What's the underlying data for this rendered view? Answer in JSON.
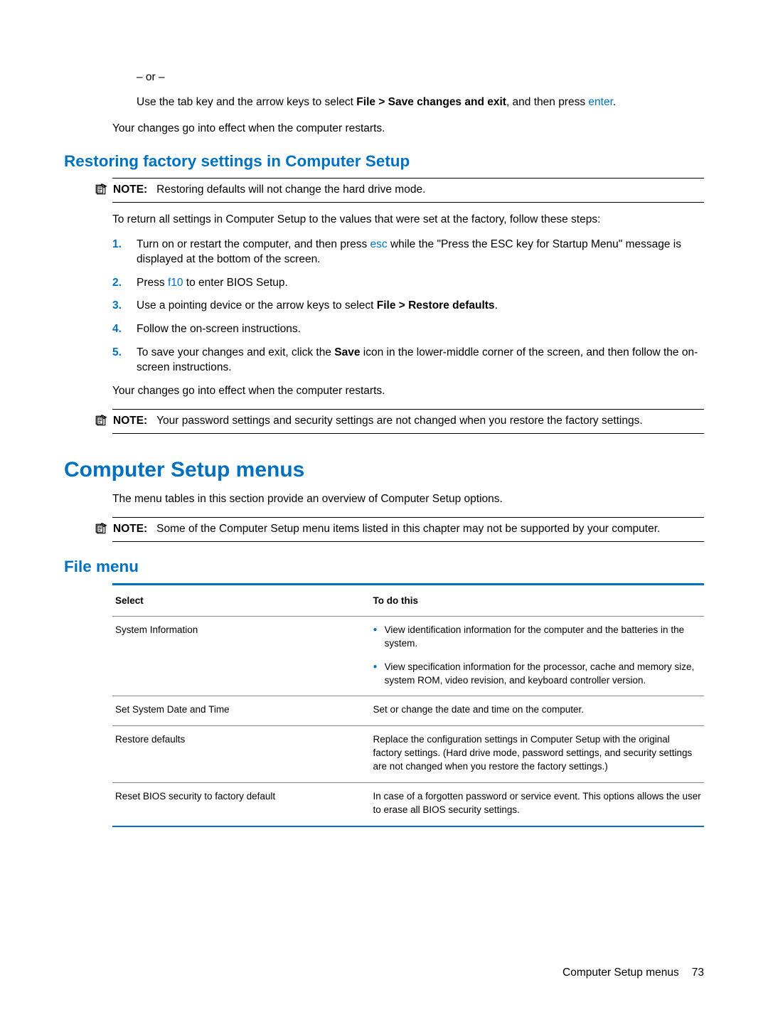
{
  "intro": {
    "or": "– or –",
    "tabkey_pre": "Use the tab key and the arrow keys to select ",
    "tabkey_bold": "File > Save changes and exit",
    "tabkey_post": ", and then press ",
    "tabkey_key": "enter",
    "tabkey_tail": ".",
    "restart": "Your changes go into effect when the computer restarts."
  },
  "restoring": {
    "heading": "Restoring factory settings in Computer Setup",
    "note1_label": "NOTE:",
    "note1_text": "Restoring defaults will not change the hard drive mode.",
    "intro": "To return all settings in Computer Setup to the values that were set at the factory, follow these steps:",
    "steps": {
      "n1": "1.",
      "s1_pre": "Turn on or restart the computer, and then press ",
      "s1_key": "esc",
      "s1_post": " while the \"Press the ESC key for Startup Menu\" message is displayed at the bottom of the screen.",
      "n2": "2.",
      "s2_pre": "Press ",
      "s2_key": "f10",
      "s2_post": " to enter BIOS Setup.",
      "n3": "3.",
      "s3_pre": "Use a pointing device or the arrow keys to select ",
      "s3_bold": "File > Restore defaults",
      "s3_post": ".",
      "n4": "4.",
      "s4": "Follow the on-screen instructions.",
      "n5": "5.",
      "s5_pre": "To save your changes and exit, click the ",
      "s5_bold": "Save",
      "s5_post": " icon in the lower-middle corner of the screen, and then follow the on-screen instructions."
    },
    "restart2": "Your changes go into effect when the computer restarts.",
    "note2_label": "NOTE:",
    "note2_text": "Your password settings and security settings are not changed when you restore the factory settings."
  },
  "menus": {
    "heading": "Computer Setup menus",
    "intro": "The menu tables in this section provide an overview of Computer Setup options.",
    "note_label": "NOTE:",
    "note_text": "Some of the Computer Setup menu items listed in this chapter may not be supported by your computer."
  },
  "filemenu": {
    "heading": "File menu",
    "th1": "Select",
    "th2": "To do this",
    "r1_c1": "System Information",
    "r1_b1": "View identification information for the computer and the batteries in the system.",
    "r1_b2": "View specification information for the processor, cache and memory size, system ROM, video revision, and keyboard controller version.",
    "r2_c1": "Set System Date and Time",
    "r2_c2": "Set or change the date and time on the computer.",
    "r3_c1": "Restore defaults",
    "r3_c2": "Replace the configuration settings in Computer Setup with the original factory settings. (Hard drive mode, password settings, and security settings are not changed when you restore the factory settings.)",
    "r4_c1": "Reset BIOS security to factory default",
    "r4_c2": "In case of a forgotten password or service event. This options allows the user to erase all BIOS security settings."
  },
  "footer": {
    "section": "Computer Setup menus",
    "page": "73"
  }
}
